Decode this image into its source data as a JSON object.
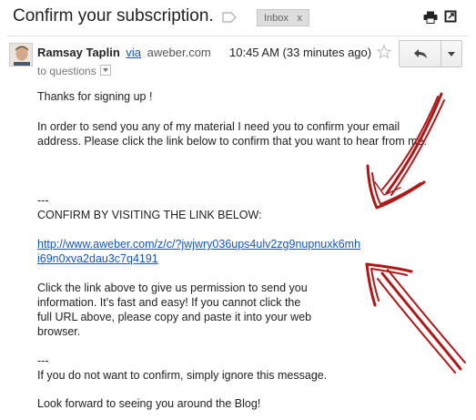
{
  "header": {
    "subject": "Confirm your subscription.",
    "label_chip": "Inbox",
    "label_chip_close": "x"
  },
  "sender": {
    "name": "Ramsay Taplin",
    "via": "via",
    "domain": "aweber.com",
    "time": "10:45 AM (33 minutes ago)",
    "recipient": "to questions"
  },
  "body": {
    "line1": "Thanks for signing up !",
    "line2a": "In order to send you any of my material I need you to confirm your email",
    "line2b": "address. Please click the link below to confirm that you want to hear from me.",
    "sep1": "---",
    "confirm_heading": "CONFIRM BY VISITING THE LINK BELOW:",
    "link_line1": "http://www.aweber.com/z/c/?jwjwry036ups4ulv2zg9nupnuxk6mh",
    "link_line2": "i69n0xva2dau3c7q4191",
    "para2_l1": "Click the link above to give us permission to send you",
    "para2_l2": "information.  It's fast and easy!  If you cannot click the",
    "para2_l3": "full URL above, please copy and paste it into your web",
    "para2_l4": "browser.",
    "sep2": "---",
    "ignore": "If you do not want to confirm, simply ignore this message.",
    "closing": "Look forward to seeing you around the Blog!"
  },
  "colors": {
    "link": "#1155cc",
    "annotation_arrow": "#b01818"
  },
  "icons": [
    "label-icon",
    "print-icon",
    "new-window-icon",
    "star-icon",
    "reply-icon",
    "dropdown-icon"
  ]
}
